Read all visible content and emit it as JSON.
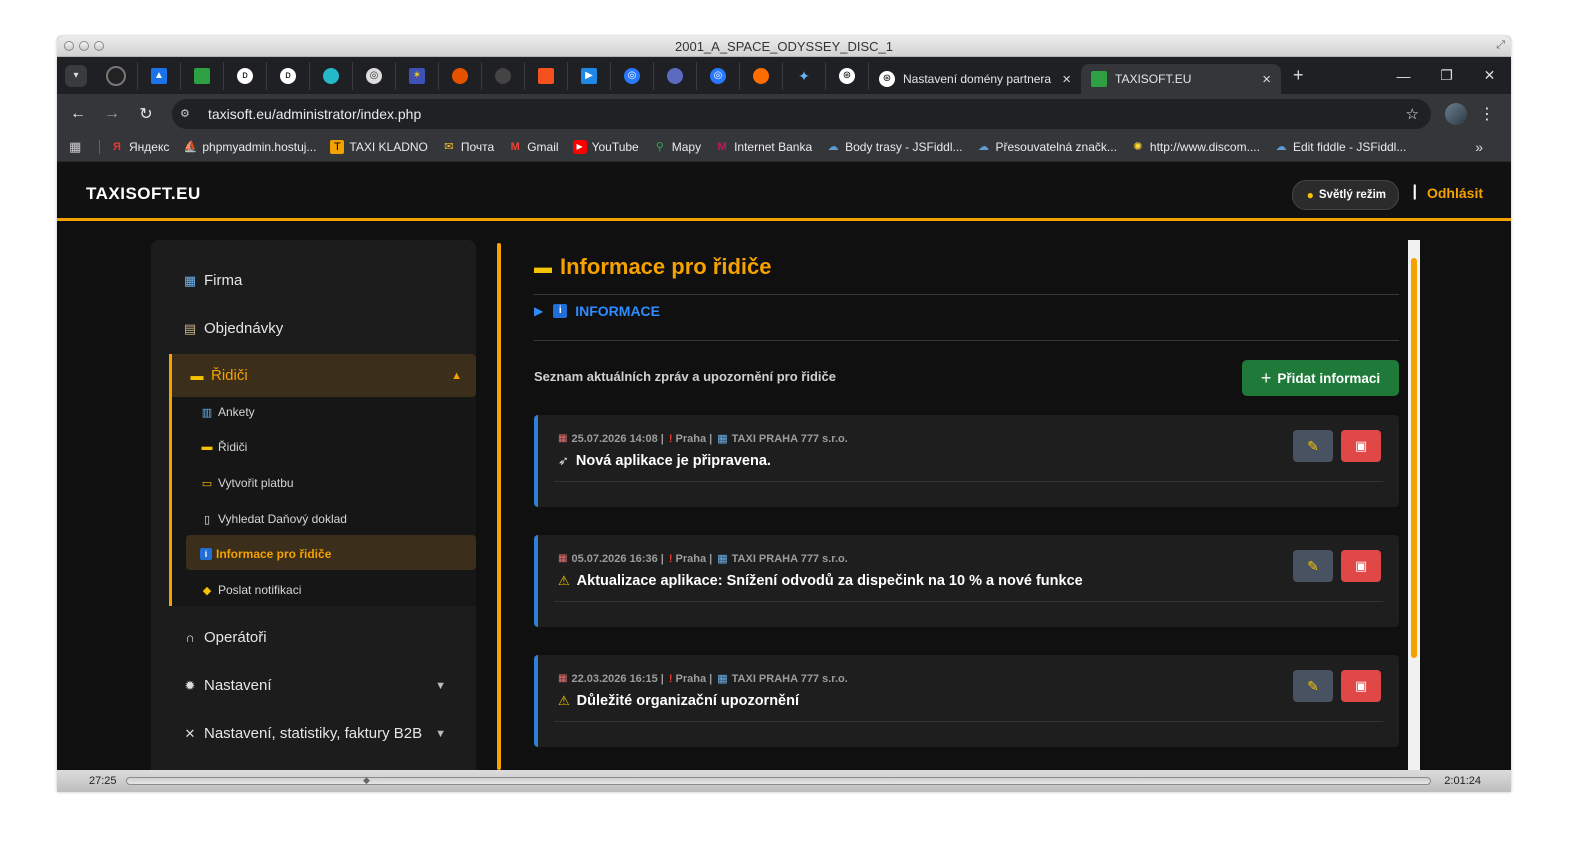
{
  "window": {
    "title": "2001_A_SPACE_ODYSSEY_DISC_1"
  },
  "browser": {
    "tabs": [
      {
        "label": "Nastavení domény partnera"
      },
      {
        "label": "TAXISOFT.EU"
      }
    ],
    "url": "taxisoft.eu/administrator/index.php",
    "bookmarks": [
      {
        "label": "Яндекс"
      },
      {
        "label": "phpmyadmin.hostuj..."
      },
      {
        "label": "TAXI KLADNO"
      },
      {
        "label": "Почта"
      },
      {
        "label": "Gmail"
      },
      {
        "label": "YouTube"
      },
      {
        "label": "Mapy"
      },
      {
        "label": "Internet Banka"
      },
      {
        "label": "Body trasy - JSFiddl..."
      },
      {
        "label": "Přesouvatelná značk..."
      },
      {
        "label": "http://www.discom...."
      },
      {
        "label": "Edit fiddle - JSFiddl..."
      }
    ],
    "more_bookmarks": "»"
  },
  "header": {
    "logo": "TAXISOFT.EU",
    "mode_button": "Světlý režim",
    "separator": "|",
    "logout": "Odhlásit"
  },
  "sidebar": {
    "items": [
      {
        "label": "Firma"
      },
      {
        "label": "Objednávky"
      },
      {
        "label": "Řidiči"
      },
      {
        "label": "Operátoři"
      },
      {
        "label": "Nastavení"
      },
      {
        "label": "Nastavení, statistiky, faktury B2B"
      }
    ],
    "subitems": [
      {
        "label": "Ankety"
      },
      {
        "label": "Řidiči"
      },
      {
        "label": "Vytvořit platbu"
      },
      {
        "label": "Vyhledat Daňový doklad"
      },
      {
        "label": "Informace pro řidiče"
      },
      {
        "label": "Poslat notifikaci"
      }
    ]
  },
  "main": {
    "title": "Informace pro řidiče",
    "info_section": "INFORMACE",
    "list_caption": "Seznam aktuálních zpráv a upozornění pro řidiče",
    "add_button": "Přidat informaci",
    "messages": [
      {
        "date": "25.07.2026 14:08",
        "city": "Praha",
        "company": "TAXI PRAHA 777 s.r.o.",
        "title": "Nová aplikace je připravena."
      },
      {
        "date": "05.07.2026 16:36",
        "city": "Praha",
        "company": "TAXI PRAHA 777 s.r.o.",
        "title": "Aktualizace aplikace: Snížení odvodů za dispečink na 10 % a nové funkce"
      },
      {
        "date": "22.03.2026 16:15",
        "city": "Praha",
        "company": "TAXI PRAHA 777 s.r.o.",
        "title": "Důležité organizační upozornění"
      }
    ]
  },
  "player": {
    "elapsed": "27:25",
    "total": "2:01:24"
  },
  "colors": {
    "accent": "#f5a100",
    "info_blue": "#2f8cff",
    "add_green": "#1f7a3a",
    "delete_red": "#e04848"
  }
}
